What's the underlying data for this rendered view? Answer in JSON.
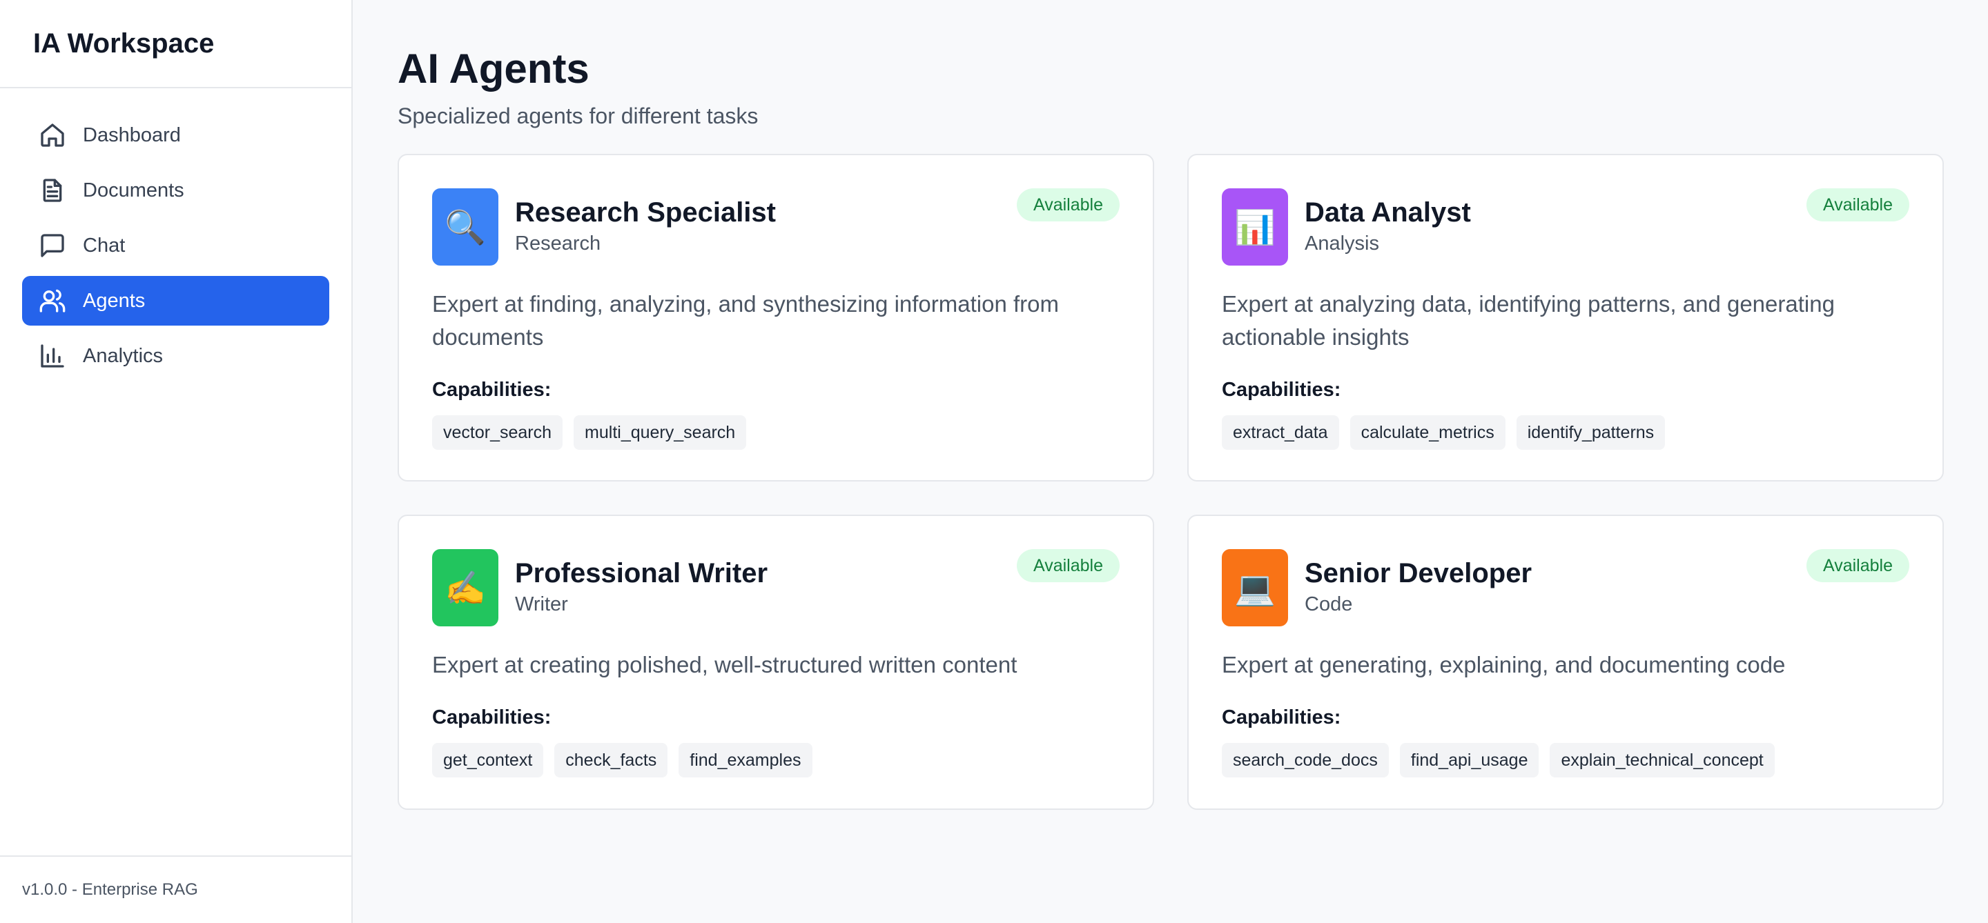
{
  "sidebar": {
    "brand": "IA Workspace",
    "items": [
      {
        "label": "Dashboard",
        "icon": "home-icon",
        "active": false
      },
      {
        "label": "Documents",
        "icon": "document-icon",
        "active": false
      },
      {
        "label": "Chat",
        "icon": "chat-icon",
        "active": false
      },
      {
        "label": "Agents",
        "icon": "users-icon",
        "active": true
      },
      {
        "label": "Analytics",
        "icon": "bar-chart-icon",
        "active": false
      }
    ],
    "version": "v1.0.0 - Enterprise RAG"
  },
  "main": {
    "title": "AI Agents",
    "subtitle": "Specialized agents for different tasks",
    "capabilities_label": "Capabilities:",
    "agents": [
      {
        "name": "Research Specialist",
        "category": "Research",
        "status": "Available",
        "icon": "🔍",
        "icon_name": "magnifier-icon",
        "color": "#3b82f6",
        "description": "Expert at finding, analyzing, and synthesizing information from documents",
        "capabilities": [
          "vector_search",
          "multi_query_search"
        ]
      },
      {
        "name": "Data Analyst",
        "category": "Analysis",
        "status": "Available",
        "icon": "📊",
        "icon_name": "bar-chart-emoji-icon",
        "color": "#a855f7",
        "description": "Expert at analyzing data, identifying patterns, and generating actionable insights",
        "capabilities": [
          "extract_data",
          "calculate_metrics",
          "identify_patterns"
        ]
      },
      {
        "name": "Professional Writer",
        "category": "Writer",
        "status": "Available",
        "icon": "✍️",
        "icon_name": "writing-hand-icon",
        "color": "#22c55e",
        "description": "Expert at creating polished, well-structured written content",
        "capabilities": [
          "get_context",
          "check_facts",
          "find_examples"
        ]
      },
      {
        "name": "Senior Developer",
        "category": "Code",
        "status": "Available",
        "icon": "💻",
        "icon_name": "laptop-icon",
        "color": "#f97316",
        "description": "Expert at generating, explaining, and documenting code",
        "capabilities": [
          "search_code_docs",
          "find_api_usage",
          "explain_technical_concept"
        ]
      }
    ]
  },
  "colors": {
    "accent": "#2563eb",
    "status_bg": "#dcfce7",
    "status_text": "#15803d"
  }
}
